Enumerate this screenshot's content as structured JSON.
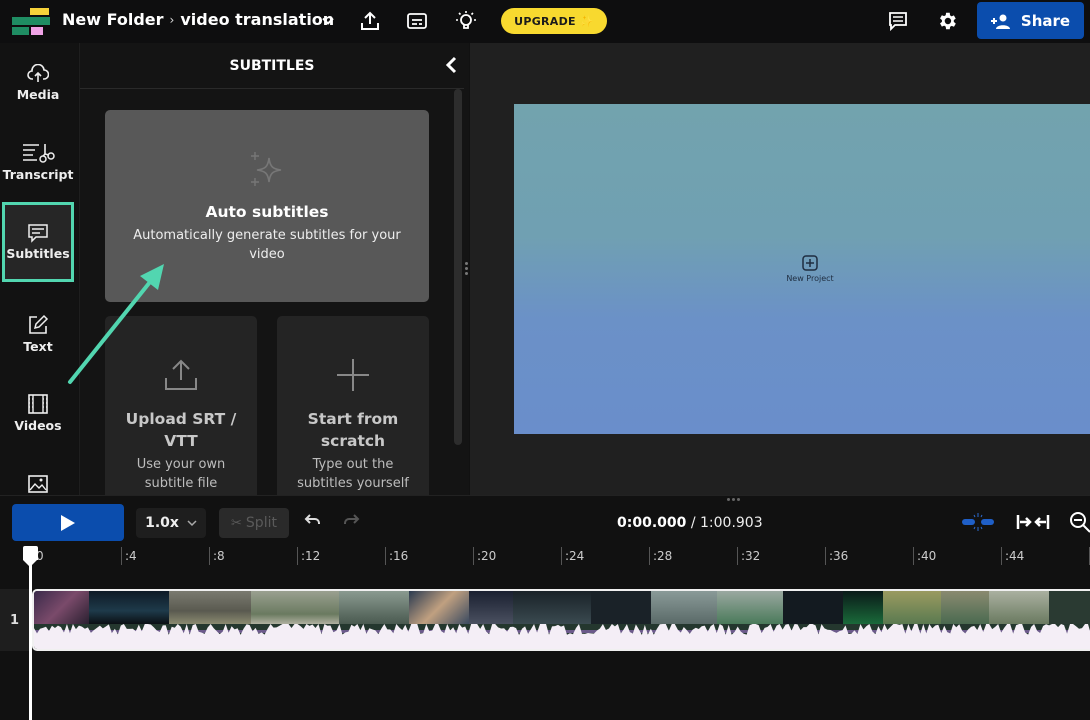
{
  "topbar": {
    "folder": "New Folder",
    "separator": "›",
    "project_name": "video translation",
    "upgrade_label": "UPGRADE",
    "share_label": "Share"
  },
  "nav": {
    "items": [
      {
        "label": "Media",
        "icon": "cloud-upload-icon"
      },
      {
        "label": "Transcript",
        "icon": "transcript-icon"
      },
      {
        "label": "Subtitles",
        "icon": "subtitles-icon",
        "active": true
      },
      {
        "label": "Text",
        "icon": "text-edit-icon"
      },
      {
        "label": "Videos",
        "icon": "film-icon"
      },
      {
        "label": "Images",
        "icon": "image-icon"
      }
    ]
  },
  "panel": {
    "title": "SUBTITLES",
    "cards": {
      "auto": {
        "title": "Auto subtitles",
        "desc": "Automatically generate subtitles for your video"
      },
      "upload": {
        "title": "Upload SRT / VTT",
        "desc": "Use your own subtitle file"
      },
      "scratch": {
        "title": "Start from scratch",
        "desc": "Type out the subtitles yourself"
      }
    }
  },
  "canvas": {
    "new_project_label": "New Project"
  },
  "timeline": {
    "speed": "1.0x",
    "split_label": "Split",
    "current_time": "0:00.000",
    "time_separator": " / ",
    "total_time": "1:00.903",
    "ruler": [
      "0",
      ":4",
      ":8",
      ":12",
      ":16",
      ":20",
      ":24",
      ":28",
      ":32",
      ":36",
      ":40",
      ":44"
    ],
    "track_number": "1"
  },
  "colors": {
    "accent_blue": "#0b4dad",
    "upgrade_yellow": "#f8d92f",
    "highlight_teal": "#52d6b0"
  }
}
